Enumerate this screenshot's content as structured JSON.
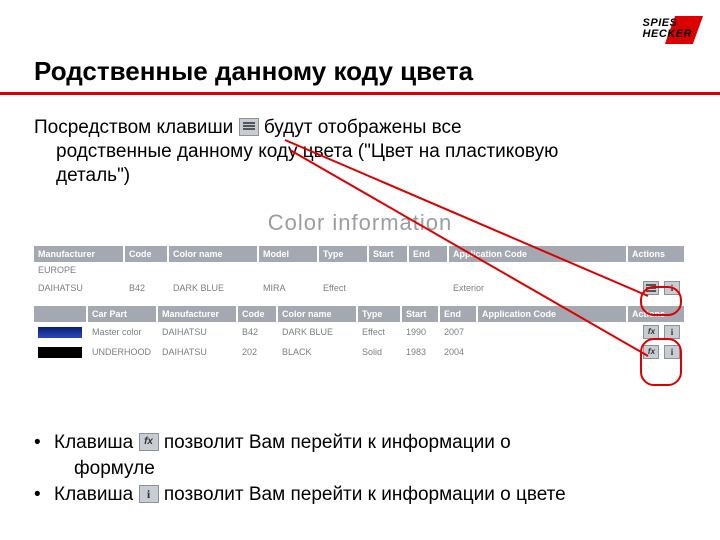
{
  "brand": {
    "line1": "SPIES",
    "line2": "HECKER"
  },
  "title": "Родственные данному коду цвета",
  "intro": {
    "part1": "Посредством клавиши ",
    "part2": " будут отображены все",
    "line2": "родственные данному коду цвета (\"Цвет на пластиковую",
    "line3": "деталь\")"
  },
  "panel_title": "Color information",
  "table1": {
    "headers": [
      "Manufacturer",
      "Code",
      "Color name",
      "Model",
      "Type",
      "Start",
      "End",
      "Application Code",
      "Actions"
    ],
    "rows": [
      {
        "manufacturer": "EUROPE"
      },
      {
        "manufacturer": "DAIHATSU",
        "code": "B42",
        "colorname": "DARK BLUE",
        "model": "MIRA",
        "type": "Effect",
        "start": "",
        "end": "",
        "appcode": "Exterior"
      }
    ]
  },
  "table2": {
    "headers": [
      "",
      "Car Part",
      "Manufacturer",
      "Code",
      "Color name",
      "Type",
      "Start",
      "End",
      "Application Code",
      "Actions"
    ],
    "rows": [
      {
        "swatch": "blue",
        "carpart": "Master color",
        "manufacturer": "DAIHATSU",
        "code": "B42",
        "colorname": "DARK BLUE",
        "type": "Effect",
        "start": "1990",
        "end": "2007",
        "appcode": ""
      },
      {
        "swatch": "black",
        "carpart": "UNDERHOOD",
        "manufacturer": "DAIHATSU",
        "code": "202",
        "colorname": "BLACK",
        "type": "Solid",
        "start": "1983",
        "end": "2004",
        "appcode": ""
      }
    ]
  },
  "bullets": {
    "b1a": "Клавиша ",
    "b1b": " позволит Вам перейти к информации о",
    "b1c": "формуле",
    "b2a": "Клавиша ",
    "b2b": " позволит Вам перейти к информации о цвете"
  }
}
